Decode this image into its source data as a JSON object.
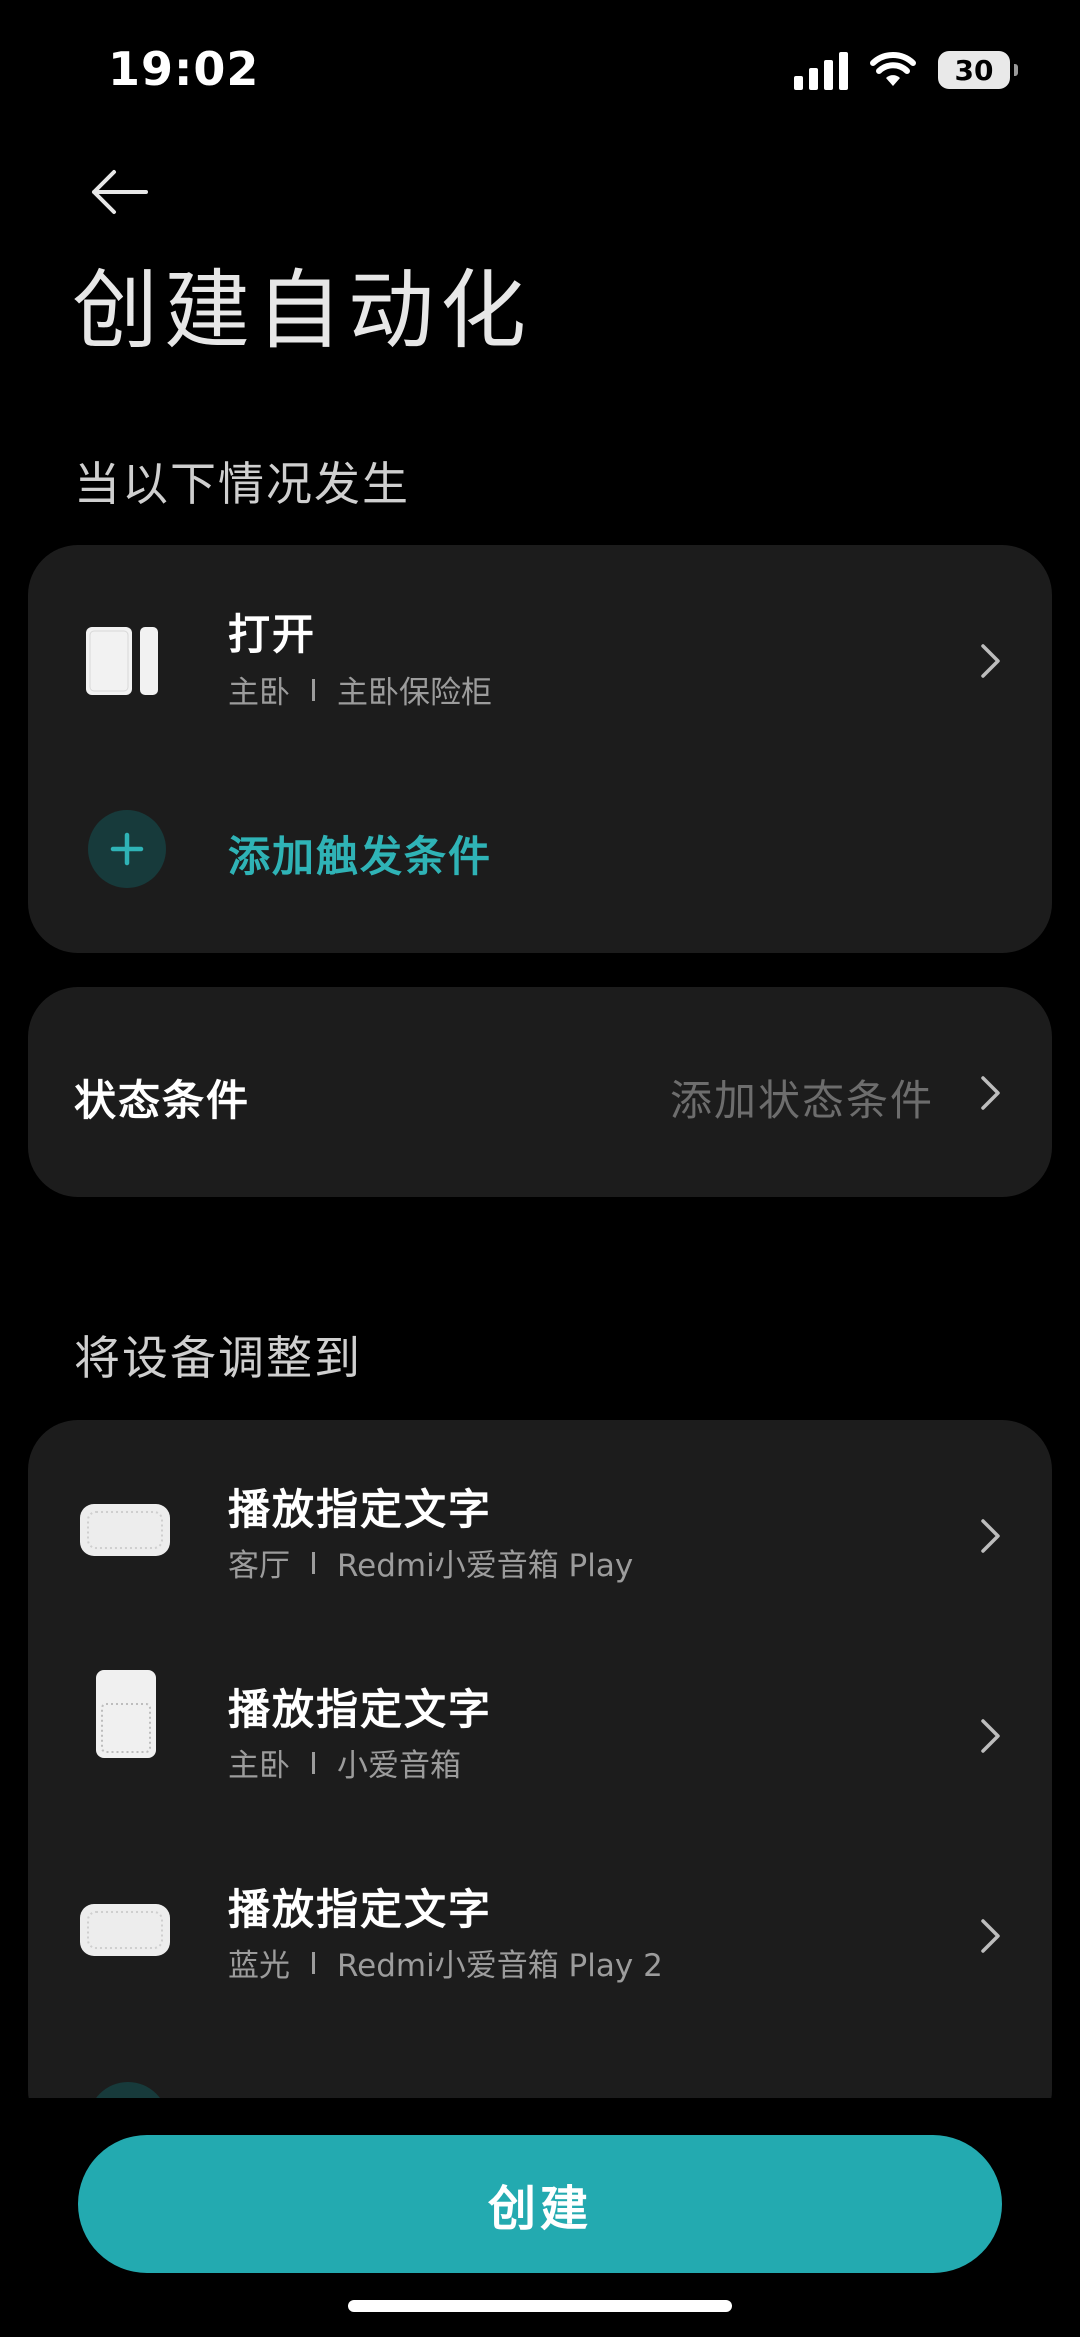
{
  "status_bar": {
    "time": "19:02",
    "battery": "30"
  },
  "header": {
    "title": "创建自动化"
  },
  "trigger_section": {
    "label": "当以下情况发生",
    "trigger": {
      "title": "打开",
      "room": "主卧",
      "device": "主卧保险柜",
      "icon": "door-sensor-icon"
    },
    "add_label": "添加触发条件"
  },
  "state_section": {
    "title": "状态条件",
    "action": "添加状态条件"
  },
  "action_section": {
    "label": "将设备调整到",
    "items": [
      {
        "title": "播放指定文字",
        "room": "客厅",
        "device": "Redmi小爱音箱 Play",
        "icon": "speaker-play-icon"
      },
      {
        "title": "播放指定文字",
        "room": "主卧",
        "device": "小爱音箱",
        "icon": "speaker-tower-icon"
      },
      {
        "title": "播放指定文字",
        "room": "蓝光",
        "device": "Redmi小爱音箱 Play 2",
        "icon": "speaker-play-icon"
      }
    ]
  },
  "footer": {
    "create_label": "创建"
  },
  "colors": {
    "accent": "#23aab0",
    "card_bg": "#1c1c1c",
    "background": "#000000"
  }
}
